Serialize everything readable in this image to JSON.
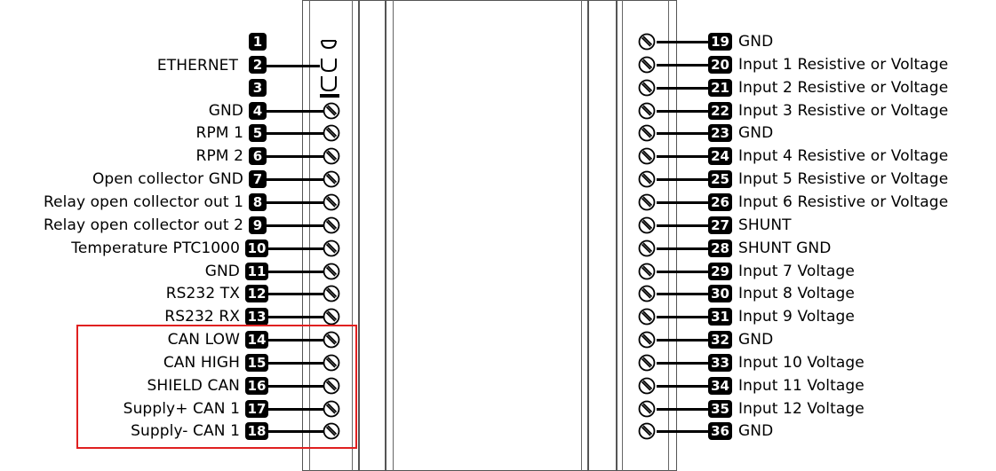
{
  "ethernet_label": "ETHERNET",
  "left_pins": [
    {
      "num": "1",
      "label": ""
    },
    {
      "num": "2",
      "label": ""
    },
    {
      "num": "3",
      "label": ""
    },
    {
      "num": "4",
      "label": "GND"
    },
    {
      "num": "5",
      "label": "RPM 1"
    },
    {
      "num": "6",
      "label": "RPM 2"
    },
    {
      "num": "7",
      "label": "Open collector GND"
    },
    {
      "num": "8",
      "label": "Relay open collector out 1"
    },
    {
      "num": "9",
      "label": "Relay open collector out 2"
    },
    {
      "num": "10",
      "label": "Temperature PTC1000"
    },
    {
      "num": "11",
      "label": "GND"
    },
    {
      "num": "12",
      "label": "RS232 TX"
    },
    {
      "num": "13",
      "label": "RS232 RX"
    },
    {
      "num": "14",
      "label": "CAN LOW"
    },
    {
      "num": "15",
      "label": "CAN HIGH"
    },
    {
      "num": "16",
      "label": "SHIELD CAN"
    },
    {
      "num": "17",
      "label": "Supply+ CAN 1"
    },
    {
      "num": "18",
      "label": "Supply- CAN 1"
    }
  ],
  "right_pins": [
    {
      "num": "19",
      "label": "GND"
    },
    {
      "num": "20",
      "label": "Input 1 Resistive or Voltage"
    },
    {
      "num": "21",
      "label": "Input 2 Resistive or Voltage"
    },
    {
      "num": "22",
      "label": "Input 3 Resistive or Voltage"
    },
    {
      "num": "23",
      "label": "GND"
    },
    {
      "num": "24",
      "label": "Input 4 Resistive or Voltage"
    },
    {
      "num": "25",
      "label": "Input 5 Resistive or Voltage"
    },
    {
      "num": "26",
      "label": "Input 6 Resistive or Voltage"
    },
    {
      "num": "27",
      "label": "SHUNT"
    },
    {
      "num": "28",
      "label": "SHUNT GND"
    },
    {
      "num": "29",
      "label": "Input 7 Voltage"
    },
    {
      "num": "30",
      "label": "Input 8 Voltage"
    },
    {
      "num": "31",
      "label": "Input 9 Voltage"
    },
    {
      "num": "32",
      "label": "GND"
    },
    {
      "num": "33",
      "label": "Input 10 Voltage"
    },
    {
      "num": "34",
      "label": "Input 11 Voltage"
    },
    {
      "num": "35",
      "label": "Input 12 Voltage"
    },
    {
      "num": "36",
      "label": "GND"
    }
  ],
  "colors": {
    "highlight": "#e02020",
    "badge": "#000000",
    "wire": "#000000"
  }
}
